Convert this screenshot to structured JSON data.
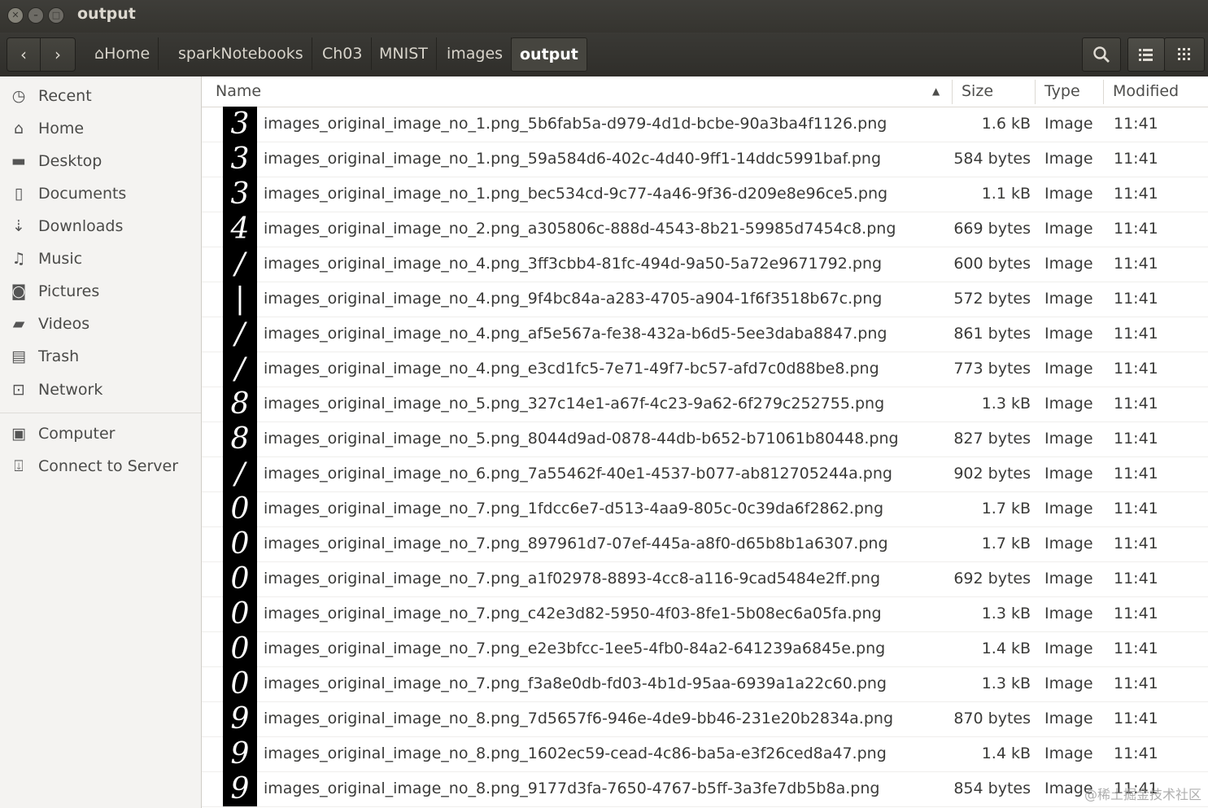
{
  "window": {
    "title": "output"
  },
  "toolbar": {
    "back_icon": "chevron-left",
    "forward_icon": "chevron-right",
    "breadcrumbs": [
      {
        "label": "Home",
        "icon": "home-icon"
      },
      {
        "label": "sparkNotebooks"
      },
      {
        "label": "Ch03"
      },
      {
        "label": "MNIST"
      },
      {
        "label": "images"
      },
      {
        "label": "output"
      }
    ]
  },
  "sidebar": {
    "items": [
      {
        "label": "Recent",
        "icon": "clock-icon"
      },
      {
        "label": "Home",
        "icon": "home-icon"
      },
      {
        "label": "Desktop",
        "icon": "folder-icon"
      },
      {
        "label": "Documents",
        "icon": "document-icon"
      },
      {
        "label": "Downloads",
        "icon": "download-icon"
      },
      {
        "label": "Music",
        "icon": "music-icon"
      },
      {
        "label": "Pictures",
        "icon": "camera-icon"
      },
      {
        "label": "Videos",
        "icon": "video-icon"
      },
      {
        "label": "Trash",
        "icon": "trash-icon"
      },
      {
        "label": "Network",
        "icon": "network-icon"
      }
    ],
    "devices": [
      {
        "label": "Computer",
        "icon": "computer-icon"
      },
      {
        "label": "Connect to Server",
        "icon": "server-icon"
      }
    ]
  },
  "columns": {
    "name": "Name",
    "size": "Size",
    "type": "Type",
    "modified": "Modified"
  },
  "files": [
    {
      "digit": "3",
      "name": "images_original_image_no_1.png_5b6fab5a-d979-4d1d-bcbe-90a3ba4f1126.png",
      "size": "1.6 kB",
      "type": "Image",
      "modified": "11:41"
    },
    {
      "digit": "3",
      "name": "images_original_image_no_1.png_59a584d6-402c-4d40-9ff1-14ddc5991baf.png",
      "size": "584 bytes",
      "type": "Image",
      "modified": "11:41"
    },
    {
      "digit": "3",
      "name": "images_original_image_no_1.png_bec534cd-9c77-4a46-9f36-d209e8e96ce5.png",
      "size": "1.1 kB",
      "type": "Image",
      "modified": "11:41"
    },
    {
      "digit": "4",
      "name": "images_original_image_no_2.png_a305806c-888d-4543-8b21-59985d7454c8.png",
      "size": "669 bytes",
      "type": "Image",
      "modified": "11:41"
    },
    {
      "digit": "/",
      "name": "images_original_image_no_4.png_3ff3cbb4-81fc-494d-9a50-5a72e9671792.png",
      "size": "600 bytes",
      "type": "Image",
      "modified": "11:41"
    },
    {
      "digit": "|",
      "name": "images_original_image_no_4.png_9f4bc84a-a283-4705-a904-1f6f3518b67c.png",
      "size": "572 bytes",
      "type": "Image",
      "modified": "11:41"
    },
    {
      "digit": "/",
      "name": "images_original_image_no_4.png_af5e567a-fe38-432a-b6d5-5ee3daba8847.png",
      "size": "861 bytes",
      "type": "Image",
      "modified": "11:41"
    },
    {
      "digit": "/",
      "name": "images_original_image_no_4.png_e3cd1fc5-7e71-49f7-bc57-afd7c0d88be8.png",
      "size": "773 bytes",
      "type": "Image",
      "modified": "11:41"
    },
    {
      "digit": "8",
      "name": "images_original_image_no_5.png_327c14e1-a67f-4c23-9a62-6f279c252755.png",
      "size": "1.3 kB",
      "type": "Image",
      "modified": "11:41"
    },
    {
      "digit": "8",
      "name": "images_original_image_no_5.png_8044d9ad-0878-44db-b652-b71061b80448.png",
      "size": "827 bytes",
      "type": "Image",
      "modified": "11:41"
    },
    {
      "digit": "/",
      "name": "images_original_image_no_6.png_7a55462f-40e1-4537-b077-ab812705244a.png",
      "size": "902 bytes",
      "type": "Image",
      "modified": "11:41"
    },
    {
      "digit": "0",
      "name": "images_original_image_no_7.png_1fdcc6e7-d513-4aa9-805c-0c39da6f2862.png",
      "size": "1.7 kB",
      "type": "Image",
      "modified": "11:41"
    },
    {
      "digit": "0",
      "name": "images_original_image_no_7.png_897961d7-07ef-445a-a8f0-d65b8b1a6307.png",
      "size": "1.7 kB",
      "type": "Image",
      "modified": "11:41"
    },
    {
      "digit": "0",
      "name": "images_original_image_no_7.png_a1f02978-8893-4cc8-a116-9cad5484e2ff.png",
      "size": "692 bytes",
      "type": "Image",
      "modified": "11:41"
    },
    {
      "digit": "0",
      "name": "images_original_image_no_7.png_c42e3d82-5950-4f03-8fe1-5b08ec6a05fa.png",
      "size": "1.3 kB",
      "type": "Image",
      "modified": "11:41"
    },
    {
      "digit": "0",
      "name": "images_original_image_no_7.png_e2e3bfcc-1ee5-4fb0-84a2-641239a6845e.png",
      "size": "1.4 kB",
      "type": "Image",
      "modified": "11:41"
    },
    {
      "digit": "0",
      "name": "images_original_image_no_7.png_f3a8e0db-fd03-4b1d-95aa-6939a1a22c60.png",
      "size": "1.3 kB",
      "type": "Image",
      "modified": "11:41"
    },
    {
      "digit": "9",
      "name": "images_original_image_no_8.png_7d5657f6-946e-4de9-bb46-231e20b2834a.png",
      "size": "870 bytes",
      "type": "Image",
      "modified": "11:41"
    },
    {
      "digit": "9",
      "name": "images_original_image_no_8.png_1602ec59-cead-4c86-ba5a-e3f26ced8a47.png",
      "size": "1.4 kB",
      "type": "Image",
      "modified": "11:41"
    },
    {
      "digit": "9",
      "name": "images_original_image_no_8.png_9177d3fa-7650-4767-b5ff-3a3fe7db5b8a.png",
      "size": "854 bytes",
      "type": "Image",
      "modified": "11:41"
    }
  ],
  "watermark": "@稀土掘金技术社区"
}
